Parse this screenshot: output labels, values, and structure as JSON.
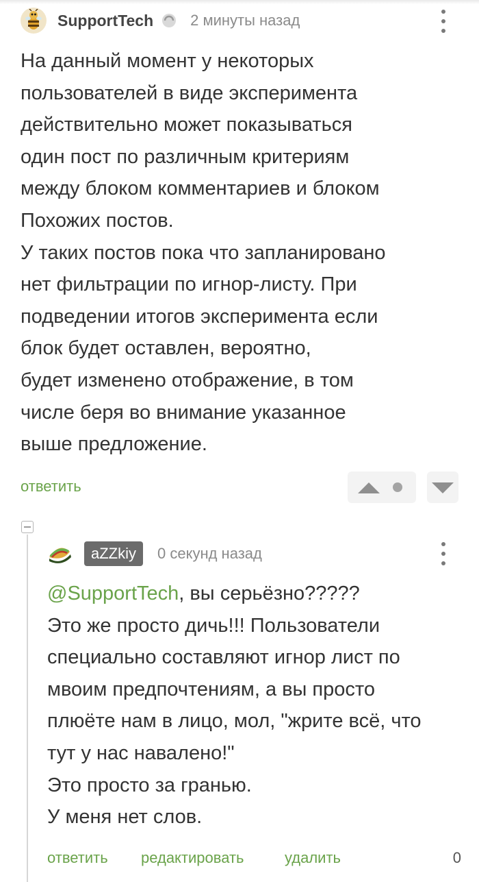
{
  "comment1": {
    "author": "SupportTech",
    "time": "2 минуты назад",
    "body_lines": [
      "На данный момент у некоторых",
      "пользователей в виде эксперимента",
      "действительно может показываться",
      "один пост по различным критериям",
      "между блоком комментариев и блоком",
      "Похожих постов.",
      "У таких постов пока что запланировано",
      "нет фильтрации по игнор-листу. При",
      "подведении итогов эксперимента если",
      "блок будет оставлен, вероятно,",
      "будет изменено отображение, в том",
      "числе беря во внимание указанное",
      "выше предложение."
    ],
    "reply_label": "ответить",
    "icons": {
      "avatar": "bee-avatar",
      "badge": "verified-icon",
      "menu": "more-vertical-icon",
      "upvote": "upvote-arrow-icon",
      "rating": "rating-dot-icon",
      "downvote": "downvote-arrow-icon"
    }
  },
  "comment2": {
    "author": "aZZkiy",
    "time": "0 секунд назад",
    "mention": "@SupportTech",
    "first_line_rest": ", вы серьёзно?????",
    "body_lines": [
      "Это же просто дичь!!! Пользователи",
      "специально составляют игнор лист по",
      "мвоим предпочтениям, а вы просто",
      "плюёте нам в лицо, мол, \"жрите всё, что",
      "тут у нас навалено!\"",
      "Это просто за гранью.",
      "У меня нет слов."
    ],
    "actions": {
      "reply": "ответить",
      "edit": "редактировать",
      "delete": "удалить"
    },
    "rating": "0",
    "icons": {
      "avatar": "taco-avatar",
      "menu": "more-vertical-icon",
      "collapse": "collapse-thread-icon"
    }
  },
  "colors": {
    "accent_green": "#6aa34a",
    "author_badge_bg": "#6b6b6b",
    "text": "#333333",
    "muted": "#8a8a8a"
  }
}
